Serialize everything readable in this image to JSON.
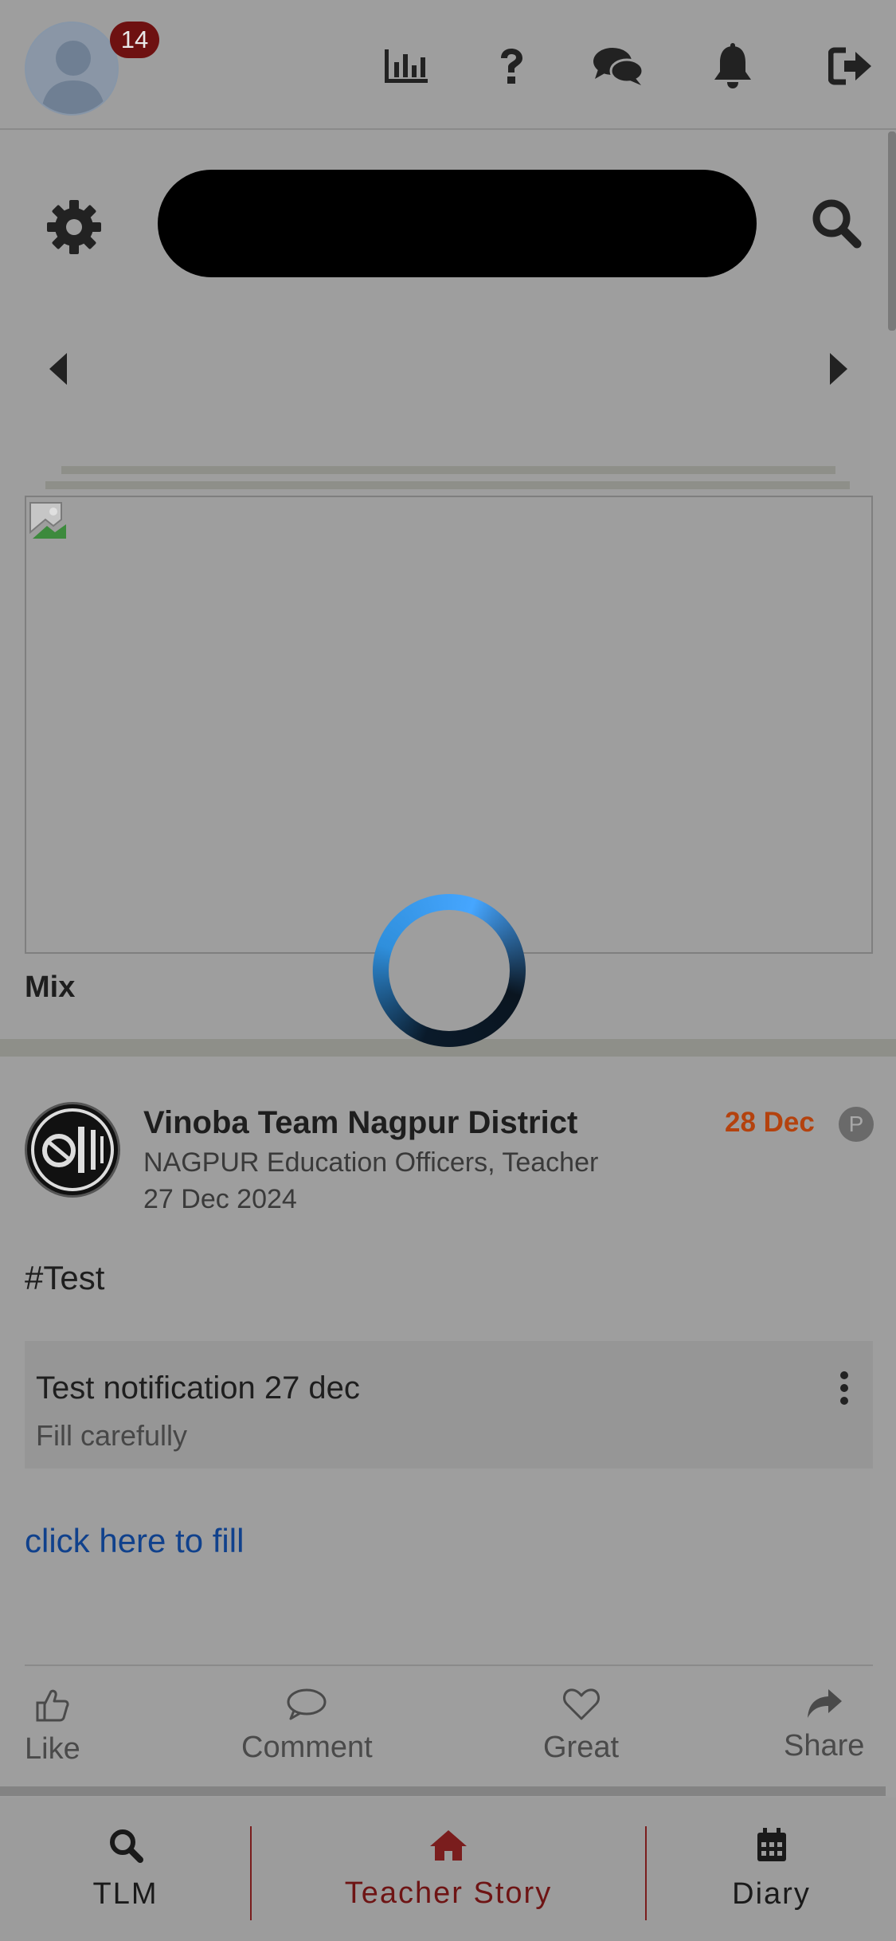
{
  "header": {
    "notification_count": "14",
    "icons": [
      "stats-icon",
      "help-icon",
      "chat-icon",
      "bell-icon",
      "logout-icon"
    ]
  },
  "search": {
    "placeholder": ""
  },
  "banner": {
    "category_label": "Mix"
  },
  "post": {
    "author": "Vinoba Team Nagpur District",
    "subtitle": "NAGPUR Education Officers, Teacher",
    "posted_date": "27 Dec 2024",
    "date_badge": "28 Dec",
    "visibility_badge": "P",
    "hashtag": "#Test",
    "notification": {
      "title": "Test notification 27 dec",
      "subtitle": "Fill carefully"
    },
    "link_text": "click here to fill",
    "actions": {
      "like": "Like",
      "comment": "Comment",
      "great": "Great",
      "share": "Share"
    }
  },
  "bottom_nav": {
    "tlm": "TLM",
    "teacher_story": "Teacher Story",
    "diary": "Diary"
  },
  "colors": {
    "accent": "#7a1d1d",
    "date_badge": "#b4420e",
    "link": "#10418c",
    "spinner": "#2f8fdc"
  }
}
